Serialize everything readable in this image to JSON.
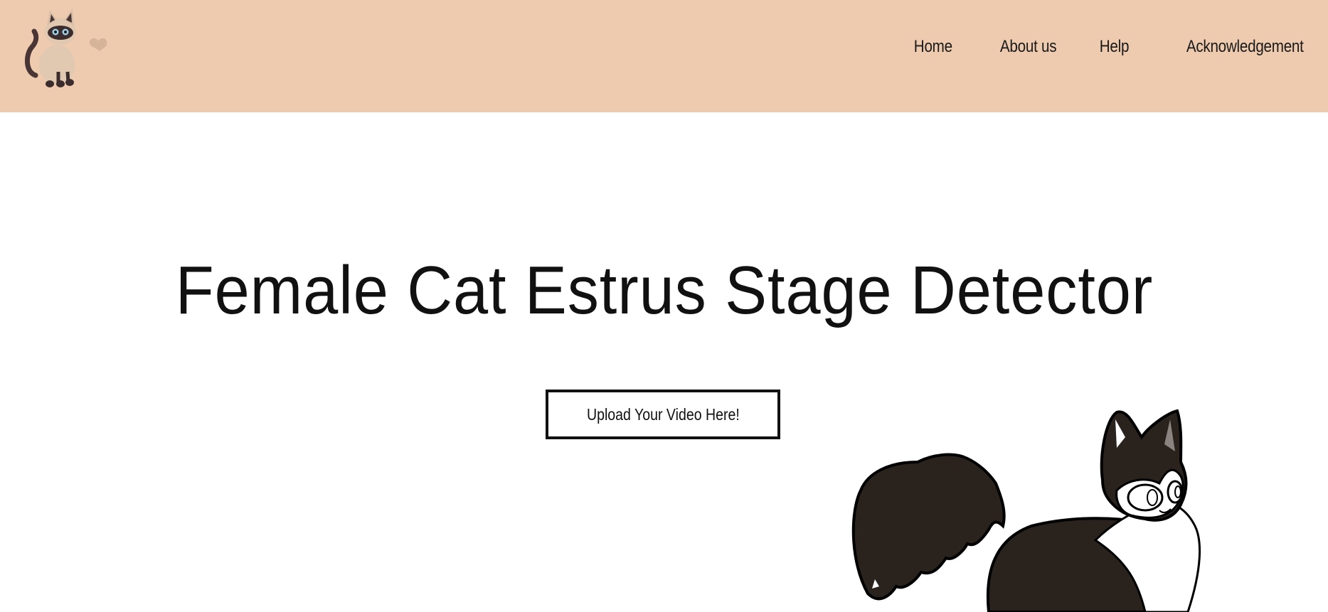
{
  "header": {
    "background_color": "#eecaaf",
    "logo_icon": "siamese-cat-with-heart-icon",
    "nav": [
      {
        "label": "Home"
      },
      {
        "label": "About us"
      },
      {
        "label": "Help"
      },
      {
        "label": "Acknowledgement"
      }
    ]
  },
  "main": {
    "title": "Female Cat Estrus Stage Detector",
    "upload_button_label": "Upload Your Video Here!",
    "illustration_icon": "black-and-white-cat-illustration"
  }
}
